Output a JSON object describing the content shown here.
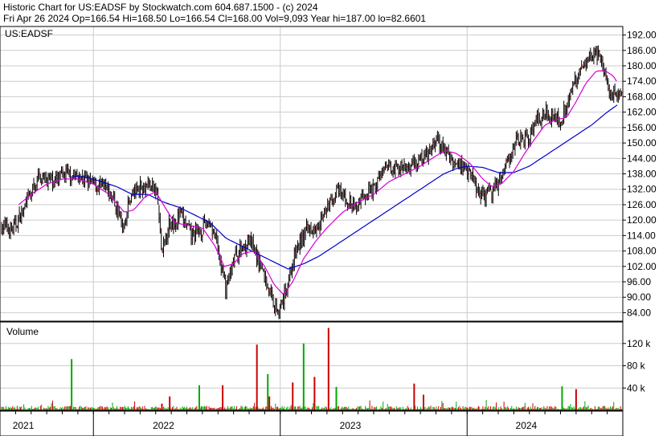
{
  "header": {
    "line1": "Historic Chart for US:EADSF by Stockwatch.com 604.687.1500 - (c) 2024",
    "line2": "Fri Apr 26 2024   Op=166.54   Hi=168.50   Lo=166.54   Cl=168.00   Vol=9,093   Year hi=187.00   lo=82.6601"
  },
  "chart_data": [
    {
      "type": "line",
      "name": "price-panel",
      "label": "US:EADSF",
      "y_ticks": [
        "192.00",
        "186.00",
        "180.00",
        "174.00",
        "168.00",
        "162.00",
        "156.00",
        "150.00",
        "144.00",
        "138.00",
        "132.00",
        "126.00",
        "120.00",
        "114.00",
        "108.00",
        "102.00",
        "96.00",
        "90.00",
        "84.00"
      ],
      "ylim": [
        80.7,
        195.3
      ],
      "grid": true,
      "x_labels": [
        "2021",
        "2022",
        "2023",
        "2024"
      ],
      "x_range_months": [
        0,
        40
      ],
      "x_label_month_centers": [
        1.5,
        10.5,
        22.5,
        33.8
      ],
      "year_boundaries_month": [
        6,
        18,
        30
      ],
      "price_close_keypoints": [
        [
          0,
          118
        ],
        [
          0.8,
          116
        ],
        [
          1.6,
          125
        ],
        [
          2.5,
          137
        ],
        [
          3.5,
          135
        ],
        [
          4.3,
          138
        ],
        [
          5,
          137
        ],
        [
          6,
          134
        ],
        [
          6.6,
          133
        ],
        [
          7.3,
          128
        ],
        [
          7.9,
          117
        ],
        [
          8.4,
          130
        ],
        [
          9,
          133
        ],
        [
          9.6,
          134
        ],
        [
          10.1,
          130
        ],
        [
          10.4,
          106
        ],
        [
          10.8,
          118
        ],
        [
          11.6,
          122
        ],
        [
          12.3,
          114
        ],
        [
          12.9,
          116
        ],
        [
          13.5,
          120
        ],
        [
          14,
          108
        ],
        [
          14.5,
          93
        ],
        [
          15,
          105
        ],
        [
          15.5,
          109
        ],
        [
          16,
          112
        ],
        [
          16.7,
          103
        ],
        [
          17.2,
          94
        ],
        [
          17.6,
          88
        ],
        [
          18,
          85
        ],
        [
          18.4,
          94
        ],
        [
          19,
          108
        ],
        [
          19.7,
          116
        ],
        [
          20.4,
          119
        ],
        [
          21,
          124
        ],
        [
          21.6,
          131
        ],
        [
          22.3,
          128
        ],
        [
          22.8,
          124
        ],
        [
          23.3,
          130
        ],
        [
          24,
          132
        ],
        [
          24.6,
          139
        ],
        [
          25.2,
          141
        ],
        [
          26,
          140
        ],
        [
          26.8,
          143
        ],
        [
          27.5,
          145
        ],
        [
          28,
          151
        ],
        [
          28.6,
          147
        ],
        [
          29.2,
          142
        ],
        [
          29.7,
          141
        ],
        [
          30.2,
          140
        ],
        [
          30.6,
          132
        ],
        [
          31.2,
          130
        ],
        [
          31.7,
          131
        ],
        [
          32.2,
          138
        ],
        [
          32.8,
          147
        ],
        [
          33.3,
          151
        ],
        [
          33.9,
          152
        ],
        [
          34.4,
          158
        ],
        [
          35,
          162
        ],
        [
          35.5,
          161
        ],
        [
          36,
          158
        ],
        [
          36.4,
          166
        ],
        [
          36.9,
          173
        ],
        [
          37.4,
          180
        ],
        [
          37.8,
          184
        ],
        [
          38.2,
          186
        ],
        [
          38.5,
          182
        ],
        [
          38.8,
          178
        ],
        [
          39.2,
          170
        ],
        [
          39.6,
          168
        ]
      ],
      "ma_short_keypoints": [
        [
          1.2,
          126
        ],
        [
          2,
          130
        ],
        [
          3,
          134
        ],
        [
          4,
          136
        ],
        [
          5,
          136
        ],
        [
          6,
          134
        ],
        [
          7,
          130
        ],
        [
          8,
          123
        ],
        [
          8.6,
          124
        ],
        [
          9.3,
          129
        ],
        [
          10,
          131
        ],
        [
          10.6,
          125
        ],
        [
          11.2,
          119
        ],
        [
          12,
          118
        ],
        [
          13,
          117
        ],
        [
          13.8,
          110
        ],
        [
          14.4,
          102
        ],
        [
          15,
          103
        ],
        [
          15.6,
          107
        ],
        [
          16.3,
          108
        ],
        [
          17,
          102
        ],
        [
          17.6,
          95
        ],
        [
          18.2,
          91
        ],
        [
          18.8,
          96
        ],
        [
          19.5,
          105
        ],
        [
          20.3,
          112
        ],
        [
          21,
          117
        ],
        [
          22,
          123
        ],
        [
          23,
          127
        ],
        [
          24,
          130
        ],
        [
          25,
          135
        ],
        [
          26,
          138
        ],
        [
          27,
          141
        ],
        [
          28,
          145
        ],
        [
          28.6,
          147
        ],
        [
          29.3,
          146
        ],
        [
          30.2,
          142
        ],
        [
          31,
          136
        ],
        [
          31.6,
          133
        ],
        [
          32.2,
          134
        ],
        [
          33,
          139
        ],
        [
          33.7,
          146
        ],
        [
          34.4,
          152
        ],
        [
          35,
          157
        ],
        [
          35.7,
          159
        ],
        [
          36.4,
          160
        ],
        [
          37,
          166
        ],
        [
          37.6,
          173
        ],
        [
          38.3,
          178
        ],
        [
          38.9,
          178
        ],
        [
          39.4,
          176
        ],
        [
          39.7,
          173
        ]
      ],
      "ma_long_keypoints": [
        [
          4.7,
          137
        ],
        [
          5.5,
          136.8
        ],
        [
          6.5,
          135
        ],
        [
          7.5,
          133
        ],
        [
          8.5,
          130
        ],
        [
          9.5,
          130
        ],
        [
          10.5,
          127
        ],
        [
          11.5,
          125
        ],
        [
          12.5,
          122
        ],
        [
          13.5,
          119
        ],
        [
          14.5,
          113
        ],
        [
          15.5,
          110
        ],
        [
          16.5,
          107
        ],
        [
          17.5,
          104
        ],
        [
          18.5,
          101
        ],
        [
          19.5,
          103
        ],
        [
          20.5,
          106
        ],
        [
          21.5,
          110
        ],
        [
          22.5,
          114
        ],
        [
          23.5,
          118
        ],
        [
          24.5,
          122
        ],
        [
          25.5,
          126
        ],
        [
          26.5,
          130
        ],
        [
          27.5,
          134
        ],
        [
          28.5,
          138
        ],
        [
          29.3,
          140
        ],
        [
          30,
          141
        ],
        [
          31,
          140.5
        ],
        [
          32,
          138.5
        ],
        [
          33,
          138.5
        ],
        [
          34,
          141
        ],
        [
          35,
          145
        ],
        [
          36,
          149
        ],
        [
          37,
          153
        ],
        [
          38,
          157
        ],
        [
          39,
          162
        ],
        [
          39.7,
          165
        ]
      ]
    },
    {
      "type": "bar",
      "name": "volume-panel",
      "label": "Volume",
      "y_ticks": [
        "120 k",
        "80 k",
        "40 k"
      ],
      "y_tick_values": [
        120000,
        80000,
        40000
      ],
      "ylim": [
        0,
        150000
      ],
      "baseline_volume": 4000,
      "spikes": [
        [
          4.6,
          92000
        ],
        [
          10.4,
          12000
        ],
        [
          10.9,
          25000
        ],
        [
          12.8,
          45000
        ],
        [
          14.3,
          45000
        ],
        [
          16.5,
          118000
        ],
        [
          17.2,
          65000
        ],
        [
          17.3,
          25000
        ],
        [
          18.8,
          50000
        ],
        [
          19.5,
          120000
        ],
        [
          20.2,
          60000
        ],
        [
          21.1,
          148000
        ],
        [
          21.6,
          42000
        ],
        [
          26.6,
          48000
        ],
        [
          27.2,
          28000
        ],
        [
          36.1,
          43000
        ],
        [
          37.0,
          38000
        ]
      ]
    }
  ],
  "colors": {
    "up": "#00aa00",
    "down": "#cc0000",
    "bar": "#000000",
    "ma_short": "#d400d4",
    "ma_long": "#0000cc",
    "grid": "#cccccc",
    "frame": "#000000"
  }
}
